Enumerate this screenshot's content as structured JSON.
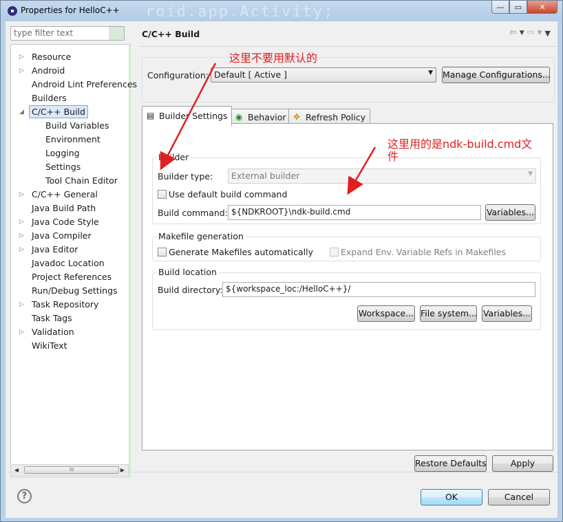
{
  "window": {
    "title": "Properties for HelloC++",
    "background_title": "roid.app.Activity;",
    "controls": {
      "minimize": "—",
      "maximize": "▭",
      "close": "✕"
    }
  },
  "filter": {
    "placeholder": "type filter text"
  },
  "tree": {
    "items": [
      {
        "label": "Resource",
        "expandable": true,
        "indent": 0
      },
      {
        "label": "Android",
        "expandable": true,
        "indent": 0
      },
      {
        "label": "Android Lint Preferences",
        "expandable": false,
        "indent": 0
      },
      {
        "label": "Builders",
        "expandable": false,
        "indent": 0
      },
      {
        "label": "C/C++ Build",
        "expandable": true,
        "expanded": true,
        "selected": true,
        "indent": 0
      },
      {
        "label": "Build Variables",
        "expandable": false,
        "indent": 1
      },
      {
        "label": "Environment",
        "expandable": false,
        "indent": 1
      },
      {
        "label": "Logging",
        "expandable": false,
        "indent": 1
      },
      {
        "label": "Settings",
        "expandable": false,
        "indent": 1
      },
      {
        "label": "Tool Chain Editor",
        "expandable": false,
        "indent": 1
      },
      {
        "label": "C/C++ General",
        "expandable": true,
        "indent": 0
      },
      {
        "label": "Java Build Path",
        "expandable": false,
        "indent": 0
      },
      {
        "label": "Java Code Style",
        "expandable": true,
        "indent": 0
      },
      {
        "label": "Java Compiler",
        "expandable": true,
        "indent": 0
      },
      {
        "label": "Java Editor",
        "expandable": true,
        "indent": 0
      },
      {
        "label": "Javadoc Location",
        "expandable": false,
        "indent": 0
      },
      {
        "label": "Project References",
        "expandable": false,
        "indent": 0
      },
      {
        "label": "Run/Debug Settings",
        "expandable": false,
        "indent": 0
      },
      {
        "label": "Task Repository",
        "expandable": true,
        "indent": 0
      },
      {
        "label": "Task Tags",
        "expandable": false,
        "indent": 0
      },
      {
        "label": "Validation",
        "expandable": true,
        "indent": 0
      },
      {
        "label": "WikiText",
        "expandable": false,
        "indent": 0
      }
    ],
    "scroll_thumb": "III"
  },
  "page": {
    "title": "C/C++ Build",
    "configuration_label": "Configuration:",
    "configuration_value": "Default  [ Active ]",
    "manage_button": "Manage Configurations..."
  },
  "tabs": [
    {
      "label": "Builder Settings",
      "active": true,
      "icon": "document-icon"
    },
    {
      "label": "Behavior",
      "active": false,
      "icon": "radio-icon"
    },
    {
      "label": "Refresh Policy",
      "active": false,
      "icon": "refresh-icon"
    }
  ],
  "builder": {
    "group_title": "Builder",
    "type_label": "Builder type:",
    "type_value": "External builder",
    "use_default_label": "Use default build command",
    "use_default_checked": false,
    "command_label": "Build command:",
    "command_value": "${NDKROOT}\\ndk-build.cmd",
    "variables_button": "Variables..."
  },
  "makefile": {
    "group_title": "Makefile generation",
    "generate_label": "Generate Makefiles automatically",
    "generate_checked": false,
    "expand_label": "Expand Env. Variable Refs in Makefiles",
    "expand_checked": false
  },
  "location": {
    "group_title": "Build location",
    "dir_label": "Build directory:",
    "dir_value": "${workspace_loc:/HelloC++}/",
    "workspace_button": "Workspace...",
    "filesystem_button": "File system...",
    "variables_button": "Variables..."
  },
  "footer": {
    "restore_button": "Restore Defaults",
    "apply_button": "Apply",
    "ok_button": "OK",
    "cancel_button": "Cancel",
    "help": "?"
  },
  "annotations": {
    "note1": "这里不要用默认的",
    "note2_line1": "这里用的是ndk-build.cmd文",
    "note2_line2": "件",
    "color": "#e02020"
  }
}
